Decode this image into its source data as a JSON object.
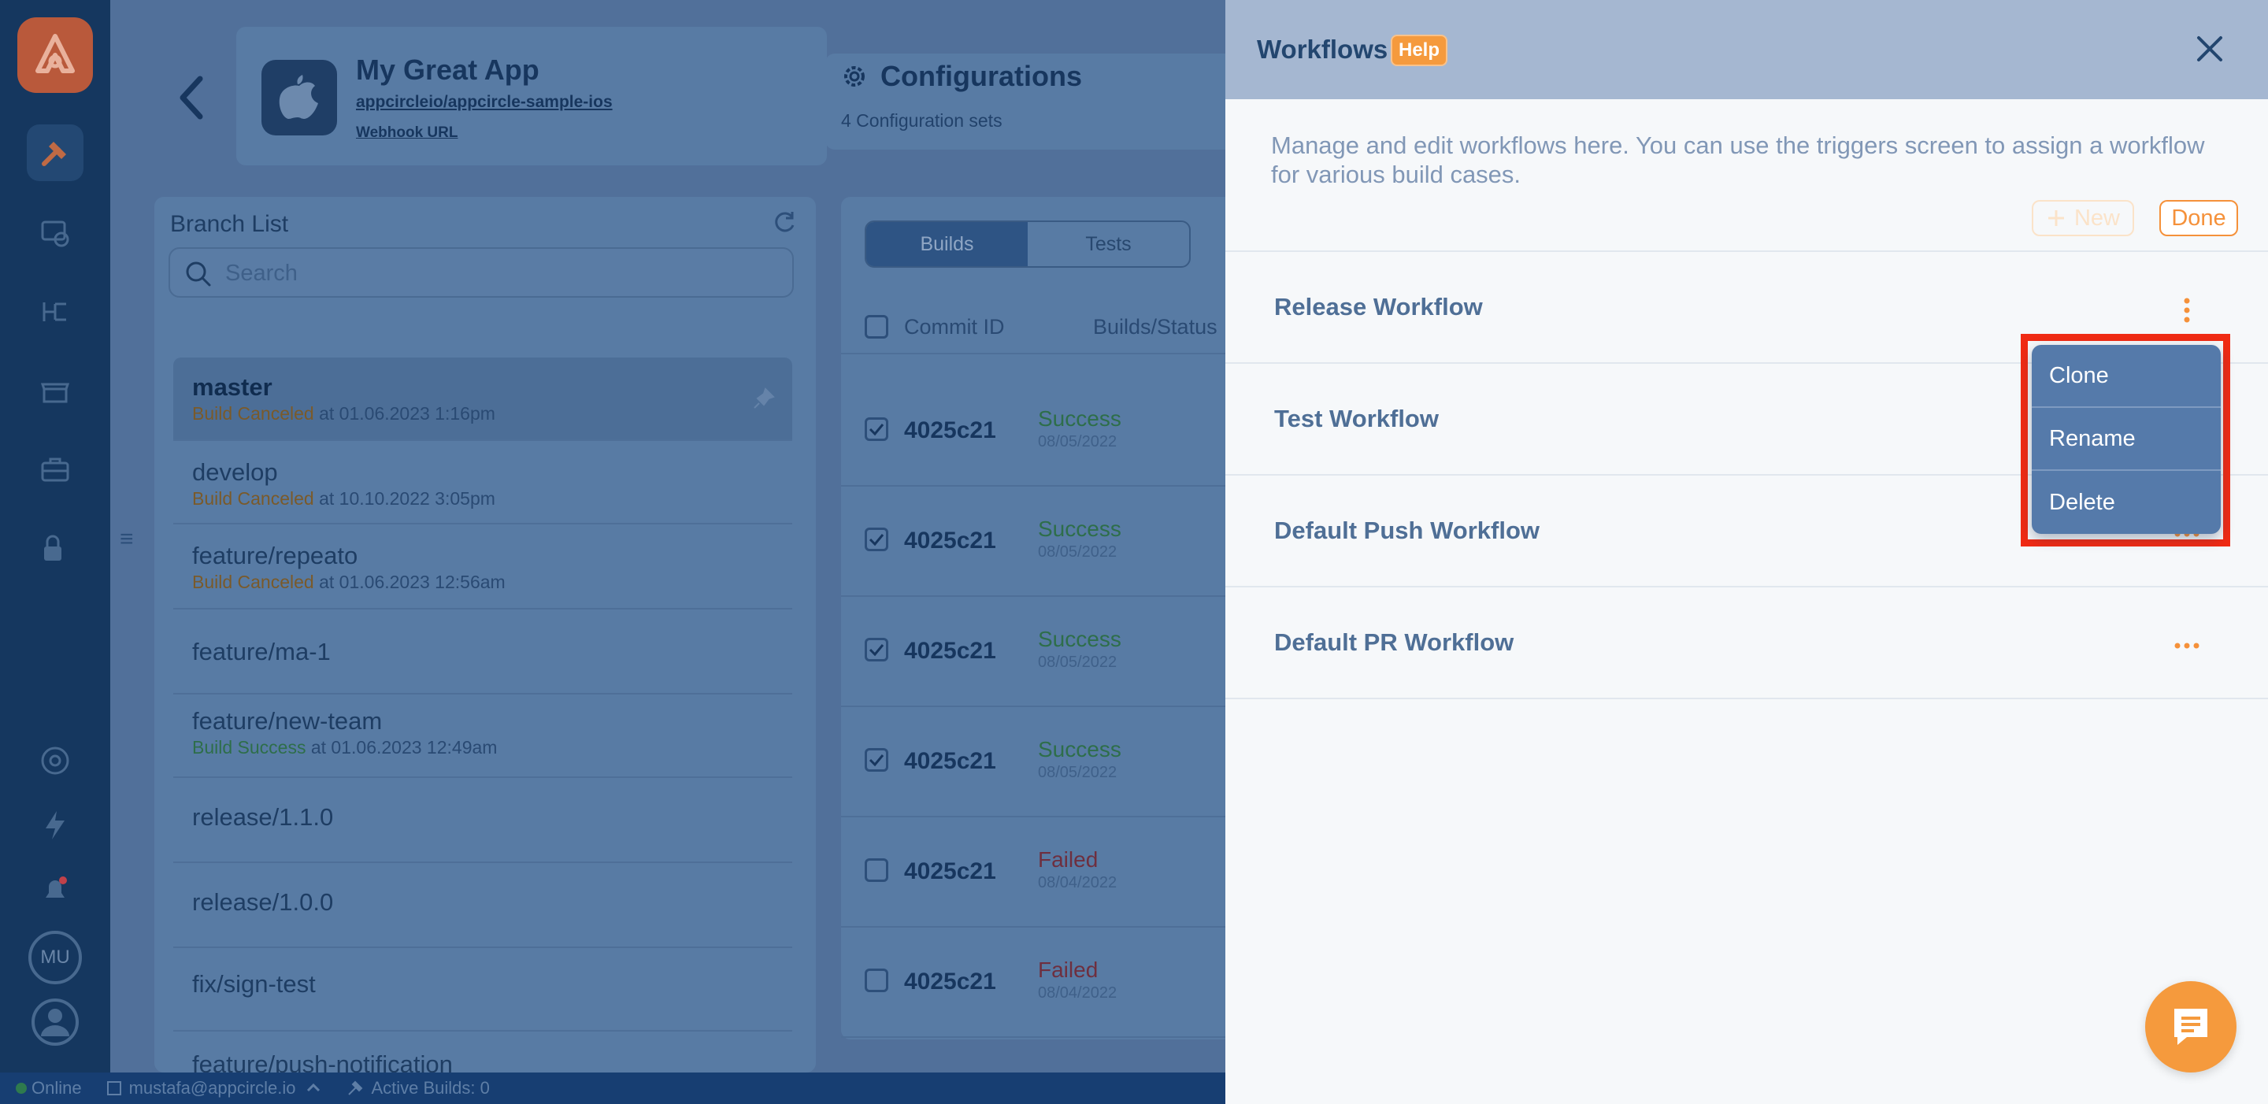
{
  "rail": {
    "icons": [
      "logo-icon",
      "build-hammer-icon",
      "testing-icon",
      "distribution-icon",
      "store-icon",
      "toolbox-icon",
      "lock-user-icon",
      "settings-icon",
      "lightning-icon",
      "notification-bell-icon",
      "user-icon"
    ],
    "avatar_initials": "MU"
  },
  "app": {
    "title": "My Great App",
    "repo": "appcircleio/appcircle-sample-ios",
    "webhook": "Webhook URL",
    "config_title": "Configurations",
    "config_sub": "4 Configuration sets"
  },
  "branch_list": {
    "title": "Branch List",
    "search_placeholder": "Search",
    "items": [
      {
        "name": "master",
        "status": "Build Canceled",
        "time": " at 01.06.2023 1:16pm"
      },
      {
        "name": "develop",
        "status": "Build Canceled",
        "time": " at 10.10.2022 3:05pm"
      },
      {
        "name": "feature/repeato",
        "status": "Build Canceled",
        "time": " at 01.06.2023 12:56am"
      },
      {
        "name": "feature/ma-1",
        "status": "",
        "time": ""
      },
      {
        "name": "feature/new-team",
        "status": "Build Success",
        "time": " at 01.06.2023 12:49am"
      },
      {
        "name": "release/1.1.0",
        "status": "",
        "time": ""
      },
      {
        "name": "release/1.0.0",
        "status": "",
        "time": ""
      },
      {
        "name": "fix/sign-test",
        "status": "",
        "time": ""
      },
      {
        "name": "feature/push-notification",
        "status": "",
        "time": ""
      }
    ]
  },
  "builds": {
    "tabs": [
      "Builds",
      "Tests"
    ],
    "col_commit": "Commit ID",
    "col_status": "Builds/Status",
    "rows": [
      {
        "commit": "4025c21",
        "status": "Success",
        "date": "08/05/2022",
        "checked": true
      },
      {
        "commit": "4025c21",
        "status": "Success",
        "date": "08/05/2022",
        "checked": true
      },
      {
        "commit": "4025c21",
        "status": "Success",
        "date": "08/05/2022",
        "checked": true
      },
      {
        "commit": "4025c21",
        "status": "Success",
        "date": "08/05/2022",
        "checked": true
      },
      {
        "commit": "4025c21",
        "status": "Failed",
        "date": "08/04/2022",
        "checked": false
      },
      {
        "commit": "4025c21",
        "status": "Failed",
        "date": "08/04/2022",
        "checked": false
      }
    ]
  },
  "statusbar": {
    "online": "Online",
    "email": "mustafa@appcircle.io",
    "active_builds": "Active Builds: 0"
  },
  "drawer": {
    "title": "Workflows",
    "help": "Help",
    "description": "Manage and edit workflows here. You can use the triggers screen to assign a workflow for various build cases.",
    "new_label": "New",
    "done_label": "Done",
    "workflows": [
      "Release Workflow",
      "Test Workflow",
      "Default Push Workflow",
      "Default PR Workflow"
    ],
    "menu": [
      "Clone",
      "Rename",
      "Delete"
    ]
  },
  "colors": {
    "accent": "#f59a3d",
    "menu_bg": "#557aaa",
    "highlight": "#f02b14",
    "header_bg": "#a5b7d1"
  }
}
